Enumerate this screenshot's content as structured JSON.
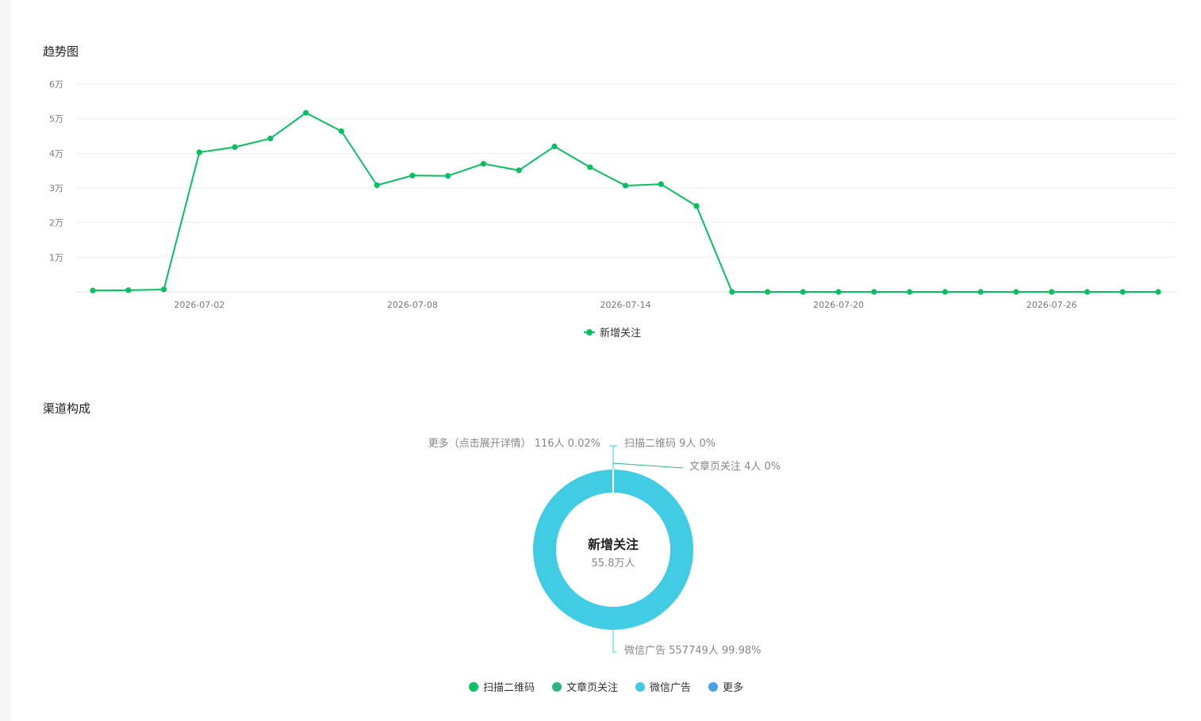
{
  "trend": {
    "title": "趋势图",
    "legend_label": "新增关注"
  },
  "channel": {
    "title": "渠道构成",
    "center_title": "新增关注",
    "center_value": "55.8万人",
    "legend": [
      {
        "label": "扫描二维码",
        "color": "#07c160"
      },
      {
        "label": "文章页关注",
        "color": "#2db37c"
      },
      {
        "label": "微信广告",
        "color": "#40cde3"
      },
      {
        "label": "更多",
        "color": "#4a9eea"
      }
    ],
    "slice_labels": [
      {
        "name": "更多（点击展开详情）",
        "detail": "116人 0.02%"
      },
      {
        "name": "扫描二维码",
        "detail": "9人 0%"
      },
      {
        "name": "文章页关注",
        "detail": "4人 0%"
      },
      {
        "name": "微信广告",
        "detail": "557749人 99.98%"
      }
    ]
  },
  "chart_data": [
    {
      "type": "line",
      "title": "趋势图",
      "series": [
        {
          "name": "新增关注",
          "color": "#07c160",
          "x": [
            "2026-06-29",
            "2026-06-30",
            "2026-07-01",
            "2026-07-02",
            "2026-07-03",
            "2026-07-04",
            "2026-07-05",
            "2026-07-06",
            "2026-07-07",
            "2026-07-08",
            "2026-07-09",
            "2026-07-10",
            "2026-07-11",
            "2026-07-12",
            "2026-07-13",
            "2026-07-14",
            "2026-07-15",
            "2026-07-16",
            "2026-07-17",
            "2026-07-18",
            "2026-07-19",
            "2026-07-20",
            "2026-07-21",
            "2026-07-22",
            "2026-07-23",
            "2026-07-24",
            "2026-07-25",
            "2026-07-26",
            "2026-07-27",
            "2026-07-28",
            "2026-07-29"
          ],
          "values": [
            400,
            500,
            700,
            40300,
            41800,
            44300,
            51700,
            46400,
            30800,
            33600,
            33500,
            37000,
            35100,
            42000,
            36000,
            30700,
            31100,
            24800,
            0,
            0,
            0,
            0,
            0,
            0,
            0,
            0,
            0,
            0,
            0,
            0,
            0
          ]
        }
      ],
      "x_ticks": [
        "2026-07-02",
        "2026-07-08",
        "2026-07-14",
        "2026-07-20",
        "2026-07-26"
      ],
      "y_ticks": [
        "1万",
        "2万",
        "3万",
        "4万",
        "5万",
        "6万"
      ],
      "ylim": [
        0,
        60000
      ],
      "grid": true,
      "legend": "bottom-center"
    },
    {
      "type": "pie",
      "title": "渠道构成",
      "labels": [
        "扫描二维码",
        "文章页关注",
        "微信广告",
        "更多"
      ],
      "values": [
        9,
        4,
        557749,
        116
      ],
      "percents": [
        "0%",
        "0%",
        "99.98%",
        "0.02%"
      ],
      "colors": [
        "#07c160",
        "#2db37c",
        "#40cde3",
        "#4a9eea"
      ],
      "center_label": "新增关注",
      "center_value": "55.8万人",
      "legend": "bottom-center"
    }
  ]
}
